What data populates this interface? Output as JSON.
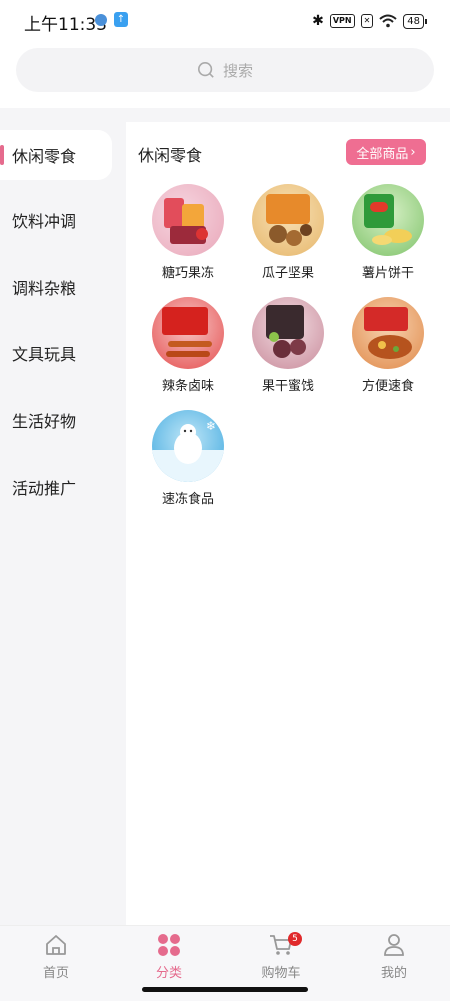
{
  "status_bar": {
    "time": "上午11:33",
    "vpn": "VPN",
    "battery": "48"
  },
  "search": {
    "placeholder": "搜索"
  },
  "sidebar": {
    "items": [
      {
        "label": "休闲零食",
        "active": true
      },
      {
        "label": "饮料冲调",
        "active": false
      },
      {
        "label": "调料杂粮",
        "active": false
      },
      {
        "label": "文具玩具",
        "active": false
      },
      {
        "label": "生活好物",
        "active": false
      },
      {
        "label": "活动推广",
        "active": false
      }
    ]
  },
  "content": {
    "title": "休闲零食",
    "all_button": "全部商品",
    "items": [
      {
        "label": "糖巧果冻"
      },
      {
        "label": "瓜子坚果"
      },
      {
        "label": "薯片饼干"
      },
      {
        "label": "辣条卤味"
      },
      {
        "label": "果干蜜饯"
      },
      {
        "label": "方便速食"
      },
      {
        "label": "速冻食品"
      }
    ]
  },
  "bottom_nav": {
    "items": [
      {
        "label": "首页",
        "icon": "home-icon"
      },
      {
        "label": "分类",
        "icon": "category-icon",
        "active": true
      },
      {
        "label": "购物车",
        "icon": "cart-icon",
        "badge": "5"
      },
      {
        "label": "我的",
        "icon": "profile-icon"
      }
    ]
  },
  "colors": {
    "accent": "#e56b8d",
    "button": "#ef6e92",
    "badge": "#e0292b"
  }
}
